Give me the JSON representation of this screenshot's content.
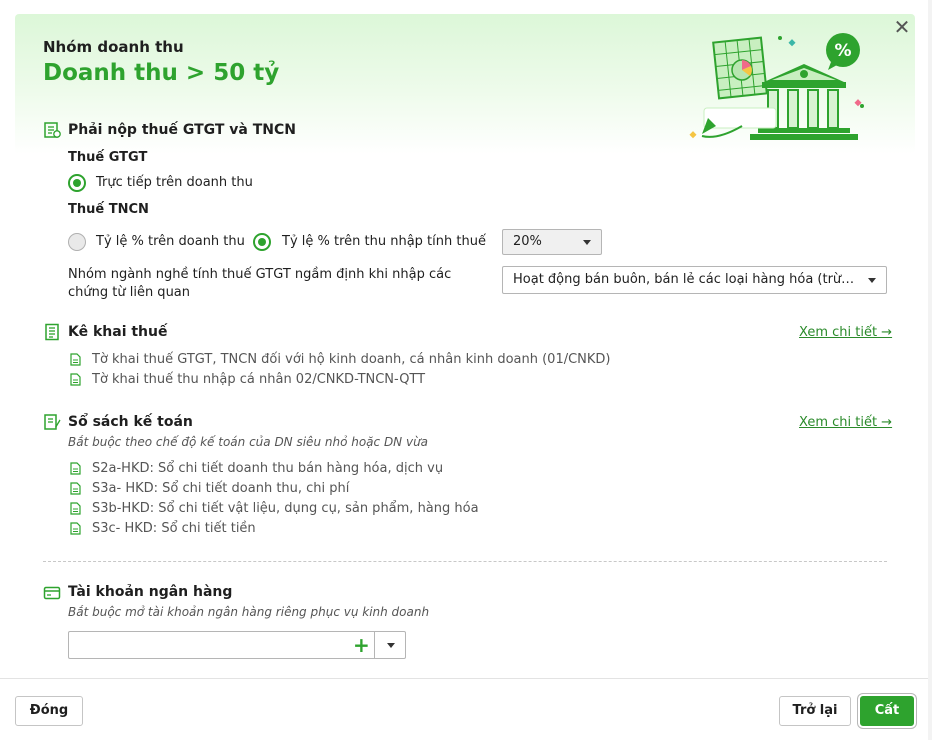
{
  "header": {
    "eyebrow": "Nhóm doanh thu",
    "title": "Doanh thu > 50 tỷ",
    "close_symbol": "✕"
  },
  "tax_section": {
    "title": "Phải nộp thuế GTGT và TNCN",
    "vat_label": "Thuế GTGT",
    "vat_option": "Trực tiếp trên doanh thu",
    "pit_label": "Thuế TNCN",
    "pit_option_revenue": "Tỷ lệ % trên doanh thu",
    "pit_option_income": "Tỷ lệ % trên thu nhập tính thuế",
    "pit_option_selected": "income",
    "rate_value": "20%",
    "industry_label_line1": "Nhóm ngành nghề tính thuế GTGT ngầm định khi nhập các",
    "industry_label_line2": "chứng từ liên quan",
    "industry_value": "Hoạt động bán buôn, bán lẻ các loại hàng hóa (trừ giá trị hàng hóa đại lý bán đúng giá hưởng hoa hồng)"
  },
  "declaration_section": {
    "title": "Kê khai thuế",
    "link": "Xem chi tiết →",
    "items": [
      "Tờ khai thuế GTGT, TNCN đối với hộ kinh doanh, cá nhân kinh doanh (01/CNKD)",
      "Tờ khai thuế thu nhập cá nhân 02/CNKD-TNCN-QTT"
    ]
  },
  "accounting_section": {
    "title": "Sổ sách kế toán",
    "link": "Xem chi tiết →",
    "note": "Bắt buộc theo chế độ kế toán của DN siêu nhỏ hoặc DN vừa",
    "items": [
      "S2a-HKD: Sổ chi tiết doanh thu bán hàng hóa, dịch vụ",
      "S3a- HKD: Sổ chi tiết doanh thu, chi phí",
      "S3b-HKD: Sổ chi tiết vật liệu, dụng cụ, sản phẩm, hàng hóa",
      "S3c- HKD: Sổ chi tiết tiền"
    ]
  },
  "bank_section": {
    "title": "Tài khoản ngân hàng",
    "note": "Bắt buộc mở tài khoản ngân hàng riêng phục vụ kinh doanh",
    "account_value": "",
    "plus_symbol": "+"
  },
  "footer": {
    "close_label": "Đóng",
    "back_label": "Trở lại",
    "save_label": "Cất"
  },
  "colors": {
    "accent": "#2ea32e",
    "link": "#2a8a2a",
    "header_bg": "#dcf7d8"
  }
}
